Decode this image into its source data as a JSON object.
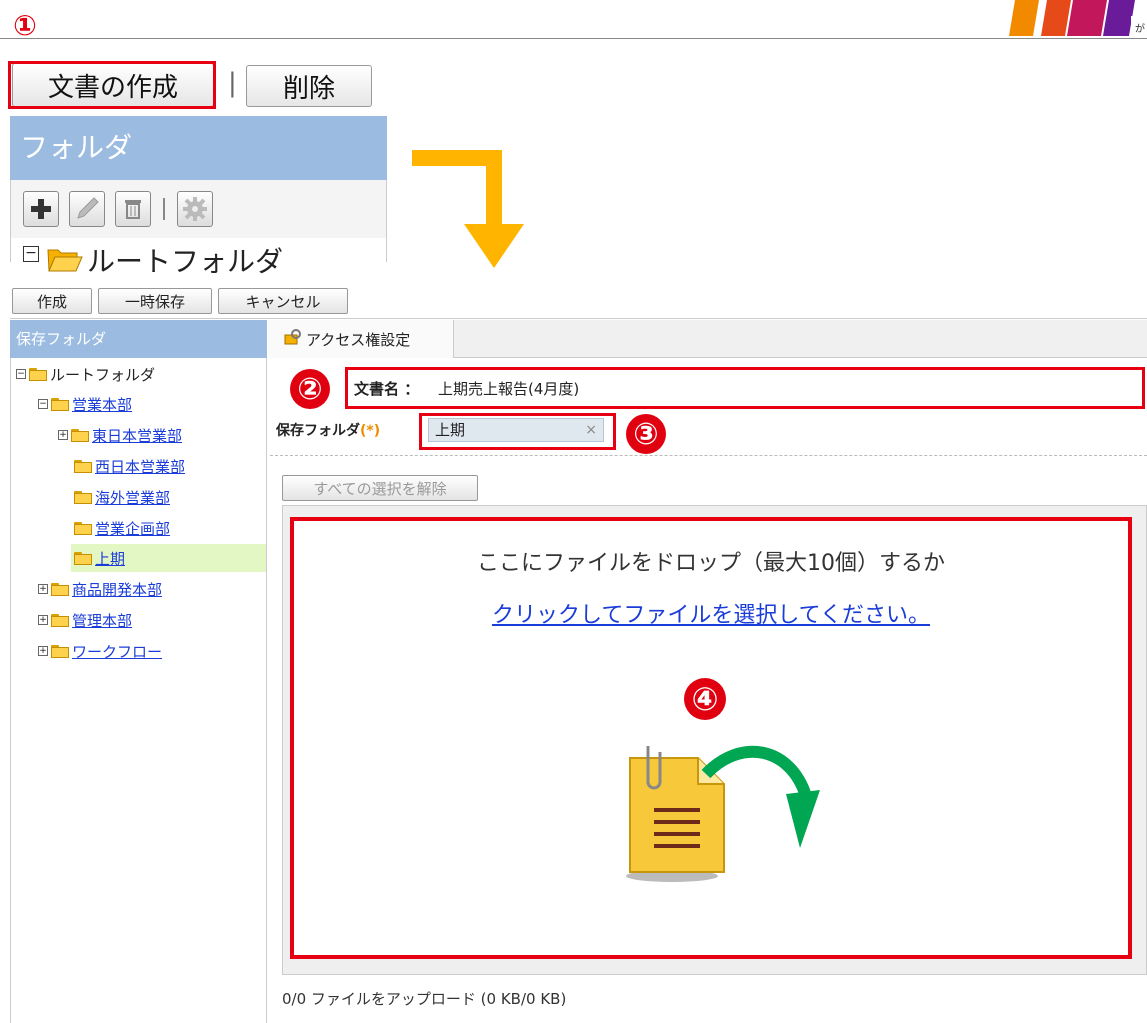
{
  "callouts": {
    "one": "①",
    "two": "②",
    "three": "③",
    "four": "④"
  },
  "logo_text": "が",
  "top_panel": {
    "create_button": "文書の作成",
    "separator": "|",
    "delete_button": "削除",
    "folder_header": "フォルダ",
    "root_folder": "ルートフォルダ"
  },
  "toolbar": {
    "create": "作成",
    "temp_save": "一時保存",
    "cancel": "キャンセル"
  },
  "sidebar": {
    "header": "保存フォルダ",
    "items": [
      {
        "label": "ルートフォルダ",
        "toggle": "⊟"
      },
      {
        "label": "営業本部",
        "toggle": "⊟"
      },
      {
        "label": "東日本営業部",
        "toggle": "⊞"
      },
      {
        "label": "西日本営業部",
        "toggle": ""
      },
      {
        "label": "海外営業部",
        "toggle": ""
      },
      {
        "label": "営業企画部",
        "toggle": ""
      },
      {
        "label": "上期",
        "toggle": ""
      },
      {
        "label": "商品開発本部",
        "toggle": "⊞"
      },
      {
        "label": "管理本部",
        "toggle": "⊞"
      },
      {
        "label": "ワークフロー",
        "toggle": "⊞"
      }
    ]
  },
  "tab": {
    "access": "アクセス権設定"
  },
  "form": {
    "doc_name_label": "文書名 ：",
    "doc_name_value": "上期売上報告(4月度)",
    "folder_label": "保存フォルダ",
    "required_mark": "(*)",
    "folder_value": "上期",
    "clear_x": "×",
    "deselect_all": "すべての選択を解除"
  },
  "dropzone": {
    "line1": "ここにファイルをドロップ（最大10個）するか",
    "link": "クリックしてファイルを選択してください。"
  },
  "status": "0/0 ファイルをアップロード (0 KB/0 KB)",
  "colors": {
    "accent_red": "#e60012",
    "header_blue": "#9bbce0",
    "arrow_orange": "#ffb400",
    "arrow_green": "#00a651"
  }
}
